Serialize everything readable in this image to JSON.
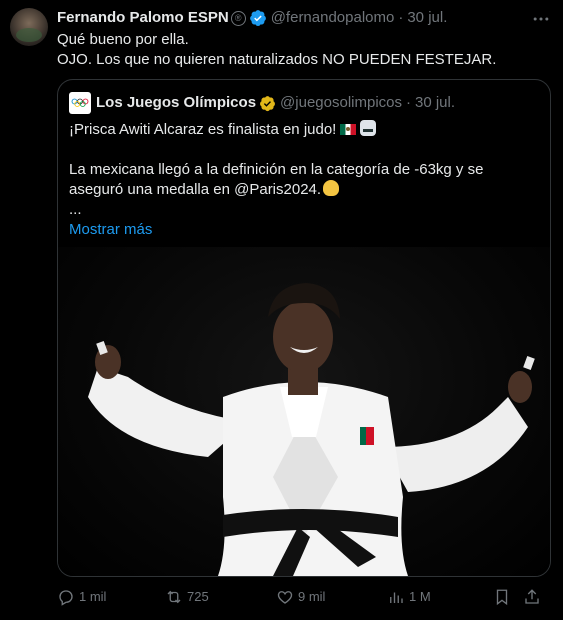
{
  "tweet": {
    "author_name": "Fernando Palomo ESPN",
    "reg_mark": "®",
    "handle": "@fernandopalomo",
    "date": "30 jul.",
    "text": "Qué bueno por ella.\nOJO. Los que no quieren naturalizados NO PUEDEN FESTEJAR."
  },
  "quote": {
    "author_name": "Los Juegos Olímpicos",
    "handle": "@juegosolimpicos",
    "date": "30 jul.",
    "line1": "¡Prisca Awiti Alcaraz es finalista en judo!",
    "line2": "La mexicana llegó a la definición en la categoría de -63kg y se aseguró una medalla en @Paris2024.",
    "ellipsis": "...",
    "show_more": "Mostrar más"
  },
  "actions": {
    "replies": "1 mil",
    "reposts": "725",
    "likes": "9 mil",
    "views": "1 M"
  },
  "icons": {
    "verified": "verified-badge-icon",
    "gold_badge": "gold-verified-badge-icon",
    "more": "more-icon",
    "reply": "reply-icon",
    "repost": "repost-icon",
    "like": "heart-icon",
    "views": "views-icon",
    "bookmark": "bookmark-icon",
    "share": "share-icon"
  },
  "colors": {
    "background": "#000000",
    "text": "#e7e9ea",
    "muted": "#71767b",
    "link": "#1d9bf0",
    "verified": "#1d9bf0",
    "gold": "#e2b719",
    "border": "#2f3336"
  }
}
